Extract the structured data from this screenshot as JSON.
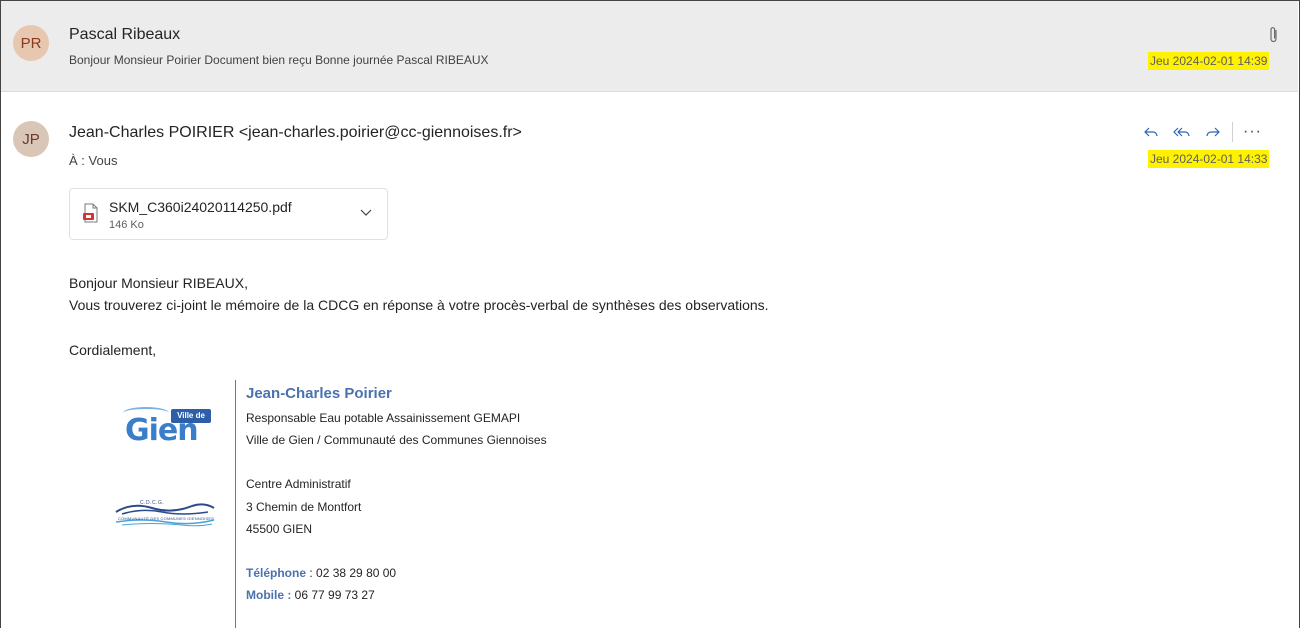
{
  "message1": {
    "avatar_initials": "PR",
    "sender": "Pascal Ribeaux",
    "preview": "Bonjour Monsieur Poirier Document bien reçu Bonne journée Pascal RIBEAUX",
    "date": "Jeu 2024-02-01 14:39",
    "has_attachment_icon": "paperclip-icon"
  },
  "message2": {
    "avatar_initials": "JP",
    "sender": "Jean-Charles POIRIER <jean-charles.poirier@cc-giennoises.fr>",
    "to_label": "À :",
    "to_value": "Vous",
    "date": "Jeu 2024-02-01 14:33",
    "actions": {
      "reply_icon": "reply-icon",
      "reply_all_icon": "reply-all-icon",
      "forward_icon": "forward-icon",
      "more_label": "···"
    },
    "attachment": {
      "file_name": "SKM_C360i24020114250.pdf",
      "file_size": "146 Ko"
    },
    "body": {
      "greeting": "Bonjour Monsieur RIBEAUX,",
      "text": "Vous trouverez ci-joint le mémoire de la CDCG en réponse à votre procès-verbal de synthèses des observations.",
      "closing": "Cordialement,"
    },
    "signature": {
      "name": "Jean-Charles Poirier",
      "role": "Responsable Eau potable Assainissement GEMAPI",
      "org": "Ville de Gien / Communauté des Communes Giennoises",
      "address1": "Centre Administratif",
      "address2": "3 Chemin de Montfort",
      "address3": "45500 GIEN",
      "phone_label": "Téléphone",
      "phone_value": " : 02 38 29 80 00",
      "mobile_label": "Mobile :",
      "mobile_value": " 06 77 99 73 27",
      "logo1_ville": "Ville de",
      "logo1_word": "Gien",
      "logo2_text": "C.D.C.G.",
      "logo2_caption": "COMMUNAUTÉ DES COMMUNES GIENNOISES"
    }
  },
  "colors": {
    "highlight": "#fff200",
    "accent": "#4a72b0"
  }
}
